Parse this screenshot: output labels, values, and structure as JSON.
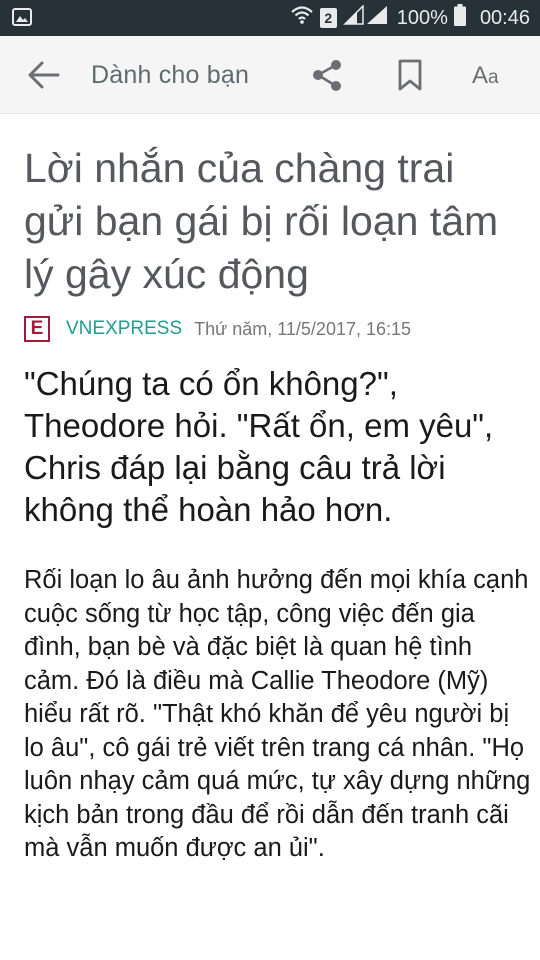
{
  "status_bar": {
    "sim_slot": "2",
    "battery": "100%",
    "time": "00:46",
    "icons": [
      "gallery-notification-icon",
      "wifi-icon",
      "signal-icon",
      "battery-icon"
    ]
  },
  "app_bar": {
    "title": "Dành cho bạn",
    "font_label_big": "A",
    "font_label_small": "a",
    "icons": [
      "back-arrow-icon",
      "share-icon",
      "bookmark-icon",
      "font-size-icon"
    ]
  },
  "article": {
    "headline": "Lời nhắn của chàng trai gửi bạn gái bị rối loạn tâm lý gây xúc động",
    "source_logo_letter": "E",
    "source_name": "VNEXPRESS",
    "date": "Thứ năm, 11/5/2017, 16:15",
    "lead": "\"Chúng ta có ổn không?\", Theodore hỏi. \"Rất ổn, em yêu\", Chris đáp lại bằng câu trả lời không thể hoàn hảo hơn.",
    "body": "Rối loạn lo âu ảnh hưởng đến mọi khía cạnh cuộc sống từ học tập, công việc đến gia đình, bạn bè và đặc biệt là quan hệ tình cảm. Đó là điều mà Callie Theodore (Mỹ) hiểu rất rõ. \"Thật khó khăn để yêu người bị lo âu\", cô gái trẻ viết trên trang cá nhân. \"Họ luôn nhạy cảm quá mức, tự xây dựng những kịch bản trong đầu để rồi dẫn đến tranh cãi mà vẫn muốn được an ủi\"."
  },
  "colors": {
    "status_bar": "#263238",
    "app_bar": "#f5f5f5",
    "headline": "#55585c",
    "source_name": "#1e9e8f",
    "source_logo": "#a8183e"
  }
}
